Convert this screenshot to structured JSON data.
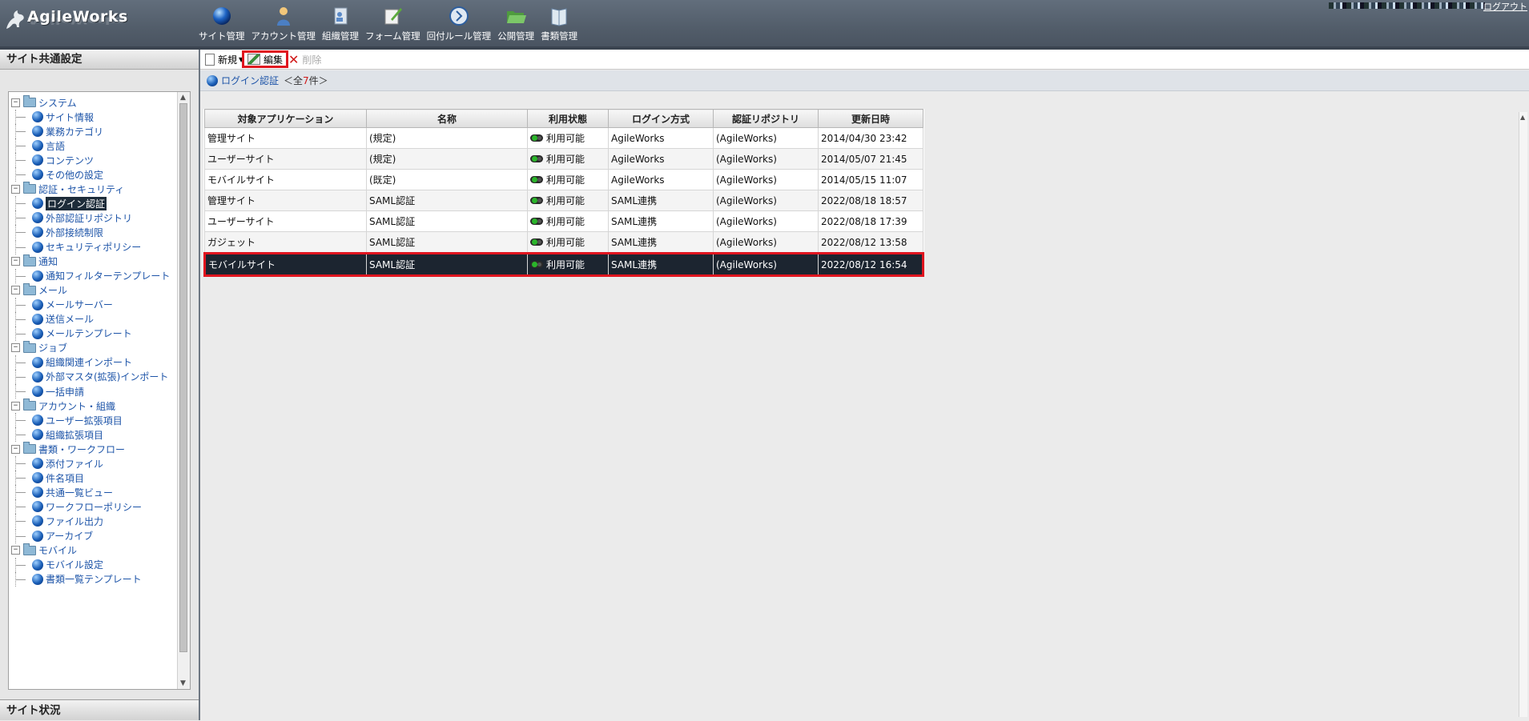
{
  "header": {
    "logo_text": "AgileWorks",
    "logout_label": "ログアウト",
    "nav": [
      {
        "label": "サイト管理",
        "icon": "globe-icon"
      },
      {
        "label": "アカウント管理",
        "icon": "person-icon"
      },
      {
        "label": "組織管理",
        "icon": "organization-icon"
      },
      {
        "label": "フォーム管理",
        "icon": "form-edit-icon"
      },
      {
        "label": "回付ルール管理",
        "icon": "route-icon"
      },
      {
        "label": "公開管理",
        "icon": "open-folder-icon"
      },
      {
        "label": "書類管理",
        "icon": "book-icon"
      }
    ]
  },
  "sidebar": {
    "title": "サイト共通設定",
    "bottom_title": "サイト状況",
    "tree": [
      {
        "label": "システム",
        "type": "category"
      },
      {
        "label": "サイト情報",
        "type": "item"
      },
      {
        "label": "業務カテゴリ",
        "type": "item"
      },
      {
        "label": "言語",
        "type": "item"
      },
      {
        "label": "コンテンツ",
        "type": "item"
      },
      {
        "label": "その他の設定",
        "type": "item"
      },
      {
        "label": "認証・セキュリティ",
        "type": "category"
      },
      {
        "label": "ログイン認証",
        "type": "item",
        "selected": true
      },
      {
        "label": "外部認証リポジトリ",
        "type": "item"
      },
      {
        "label": "外部接続制限",
        "type": "item"
      },
      {
        "label": "セキュリティポリシー",
        "type": "item"
      },
      {
        "label": "通知",
        "type": "category"
      },
      {
        "label": "通知フィルターテンプレート",
        "type": "item"
      },
      {
        "label": "メール",
        "type": "category"
      },
      {
        "label": "メールサーバー",
        "type": "item"
      },
      {
        "label": "送信メール",
        "type": "item"
      },
      {
        "label": "メールテンプレート",
        "type": "item"
      },
      {
        "label": "ジョブ",
        "type": "category"
      },
      {
        "label": "組織関連インポート",
        "type": "item"
      },
      {
        "label": "外部マスタ(拡張)インポート",
        "type": "item"
      },
      {
        "label": "一括申請",
        "type": "item"
      },
      {
        "label": "アカウント・組織",
        "type": "category"
      },
      {
        "label": "ユーザー拡張項目",
        "type": "item"
      },
      {
        "label": "組織拡張項目",
        "type": "item"
      },
      {
        "label": "書類・ワークフロー",
        "type": "category"
      },
      {
        "label": "添付ファイル",
        "type": "item"
      },
      {
        "label": "件名項目",
        "type": "item"
      },
      {
        "label": "共通一覧ビュー",
        "type": "item"
      },
      {
        "label": "ワークフローポリシー",
        "type": "item"
      },
      {
        "label": "ファイル出力",
        "type": "item"
      },
      {
        "label": "アーカイブ",
        "type": "item"
      },
      {
        "label": "モバイル",
        "type": "category"
      },
      {
        "label": "モバイル設定",
        "type": "item"
      },
      {
        "label": "書類一覧テンプレート",
        "type": "item"
      }
    ]
  },
  "toolbar": {
    "new_label": "新規",
    "edit_label": "編集",
    "delete_label": "削除"
  },
  "content": {
    "title": "ログイン認証",
    "count_prefix": "＜全",
    "count": "7",
    "count_suffix": "件＞"
  },
  "table": {
    "columns": [
      "対象アプリケーション",
      "名称",
      "利用状態",
      "ログイン方式",
      "認証リポジトリ",
      "更新日時"
    ],
    "rows": [
      [
        "管理サイト",
        "(規定)",
        "利用可能",
        "AgileWorks",
        "(AgileWorks)",
        "2014/04/30 23:42"
      ],
      [
        "ユーザーサイト",
        "(規定)",
        "利用可能",
        "AgileWorks",
        "(AgileWorks)",
        "2014/05/07 21:45"
      ],
      [
        "モバイルサイト",
        "(既定)",
        "利用可能",
        "AgileWorks",
        "(AgileWorks)",
        "2014/05/15 11:07"
      ],
      [
        "管理サイト",
        "SAML認証",
        "利用可能",
        "SAML連携",
        "(AgileWorks)",
        "2022/08/18 18:57"
      ],
      [
        "ユーザーサイト",
        "SAML認証",
        "利用可能",
        "SAML連携",
        "(AgileWorks)",
        "2022/08/18 17:39"
      ],
      [
        "ガジェット",
        "SAML認証",
        "利用可能",
        "SAML連携",
        "(AgileWorks)",
        "2022/08/12 13:58"
      ],
      [
        "モバイルサイト",
        "SAML認証",
        "利用可能",
        "SAML連携",
        "(AgileWorks)",
        "2022/08/12 16:54"
      ]
    ],
    "selected_row": 6
  },
  "colors": {
    "header_bg": "#566170",
    "highlight_red": "#e0151f",
    "link_blue": "#1d54a8",
    "selected_row_bg": "#1c2530"
  }
}
